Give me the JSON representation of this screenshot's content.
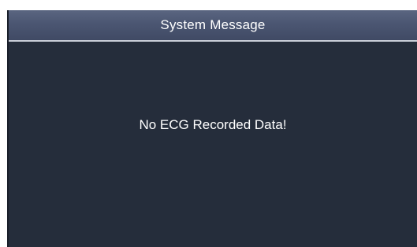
{
  "dialog": {
    "title": "System Message",
    "message": "No ECG Recorded Data!"
  },
  "colors": {
    "titlebar": "#4b5672",
    "body": "#252d3b",
    "text": "#ffffff"
  }
}
